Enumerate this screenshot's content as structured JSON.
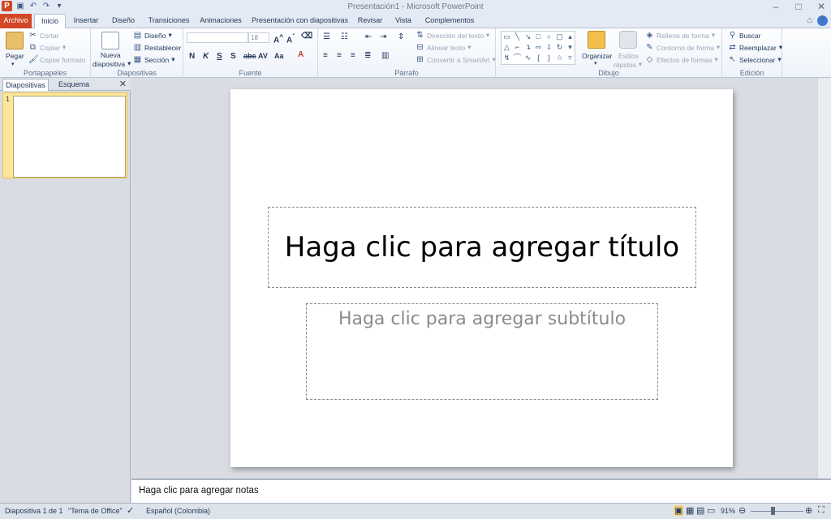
{
  "window": {
    "title": "Presentación1  -  Microsoft PowerPoint"
  },
  "tabs": {
    "file": "Archivo",
    "home": "Inicio",
    "insert": "Insertar",
    "design": "Diseño",
    "transitions": "Transiciones",
    "animations": "Animaciones",
    "slideshow": "Presentación con diapositivas",
    "review": "Revisar",
    "view": "Vista",
    "addins": "Complementos"
  },
  "ribbon": {
    "clipboard": {
      "label": "Portapapeles",
      "paste": "Pegar",
      "cut": "Cortar",
      "copy": "Copiar",
      "format_painter": "Copiar formato"
    },
    "slides": {
      "label": "Diapositivas",
      "new_slide": "Nueva",
      "new_slide_2": "diapositiva",
      "layout": "Diseño",
      "reset": "Restablecer",
      "section": "Sección"
    },
    "font": {
      "label": "Fuente",
      "font_name": "",
      "font_size": "18"
    },
    "paragraph": {
      "label": "Párrafo",
      "text_direction": "Dirección del texto",
      "align_text": "Alinear texto",
      "smartart": "Convertir a SmartArt"
    },
    "drawing": {
      "label": "Dibujo",
      "arrange": "Organizar",
      "quick_styles": "Estilos",
      "quick_styles_2": "rápidos",
      "shape_fill": "Relleno de forma",
      "shape_outline": "Contorno de forma",
      "shape_effects": "Efectos de formas"
    },
    "editing": {
      "label": "Edición",
      "find": "Buscar",
      "replace": "Reemplazar",
      "select": "Seleccionar"
    }
  },
  "left_pane": {
    "tab_slides": "Diapositivas",
    "tab_outline": "Esquema",
    "slide_number": "1"
  },
  "slide": {
    "title_placeholder": "Haga clic para agregar título",
    "subtitle_placeholder": "Haga clic para agregar subtítulo"
  },
  "notes": {
    "placeholder": "Haga clic para agregar notas"
  },
  "status": {
    "slide_count": "Diapositiva 1 de 1",
    "theme": "\"Tema de Office\"",
    "language": "Español (Colombia)",
    "zoom": "91%"
  },
  "colors": {
    "file_tab": "#d24726",
    "ribbon_bg": "#f3f6fb",
    "selected_thumb": "#fde89a"
  }
}
